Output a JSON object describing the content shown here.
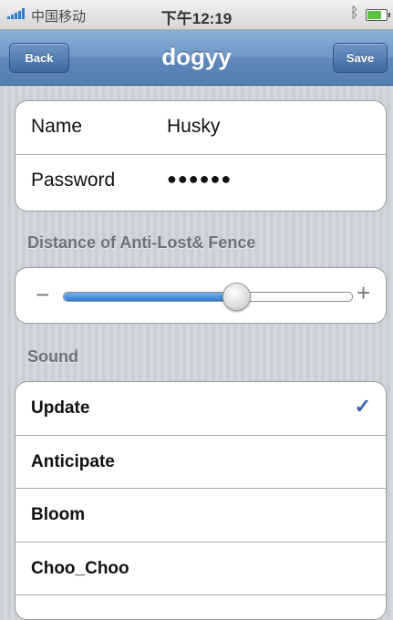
{
  "status_bar": {
    "carrier": "中国移动",
    "time": "下午12:19",
    "bluetooth_icon": "bluetooth-icon",
    "battery_icon": "battery-icon",
    "signal_icon": "signal-bars-icon"
  },
  "nav": {
    "back_label": "Back",
    "title": "dogyy",
    "save_label": "Save"
  },
  "login": {
    "name_label": "Name",
    "name_value": "Husky",
    "password_label": "Password",
    "password_value": "●●●●●●"
  },
  "distance": {
    "header": "Distance of Anti-Lost& Fence",
    "minus": "−",
    "plus": "+",
    "slider_value": 0.6
  },
  "sound": {
    "header": "Sound",
    "items": [
      {
        "label": "Update",
        "selected": true
      },
      {
        "label": "Anticipate",
        "selected": false
      },
      {
        "label": "Bloom",
        "selected": false
      },
      {
        "label": "Choo_Choo",
        "selected": false
      }
    ],
    "check_glyph": "✓"
  },
  "colors": {
    "nav_bar": "#6f97c4",
    "accent": "#2f7bd0",
    "check": "#3b64a8"
  }
}
